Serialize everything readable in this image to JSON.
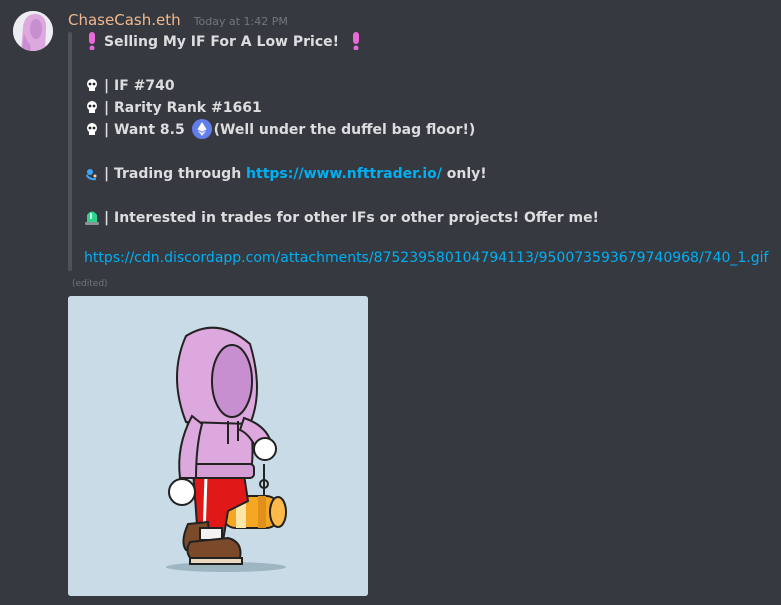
{
  "message": {
    "username": "ChaseCash.eth",
    "timestamp": "Today at 1:42 PM",
    "title": "Selling My IF For A Low Price!",
    "lines": [
      {
        "icon": "skull-icon",
        "text": "| IF #740"
      },
      {
        "icon": "skull-icon",
        "text": "| Rarity Rank #1661"
      }
    ],
    "want": {
      "prefix": "| Want 8.5",
      "suffix": "(Well under the duffel bag floor!)"
    },
    "trading": {
      "prefix": "| Trading through",
      "link": "https://www.nfttrader.io/",
      "suffix": "only!"
    },
    "interested": "| Interested in trades for other IFs or other projects! Offer me!",
    "attachment_url": "https://cdn.discordapp.com/attachments/875239580104794113/950073593679740968/740_1.gif",
    "edited_label": "(edited)"
  },
  "colors": {
    "background": "#36393f",
    "username": "#f0b98f",
    "link": "#00b0f4",
    "muted": "#72767d",
    "quote_bar": "#4f545c",
    "gif_background": "#c9dbe6",
    "hoodie": "#dca8de",
    "pants": "#e01818",
    "bag": "#f5a623"
  }
}
